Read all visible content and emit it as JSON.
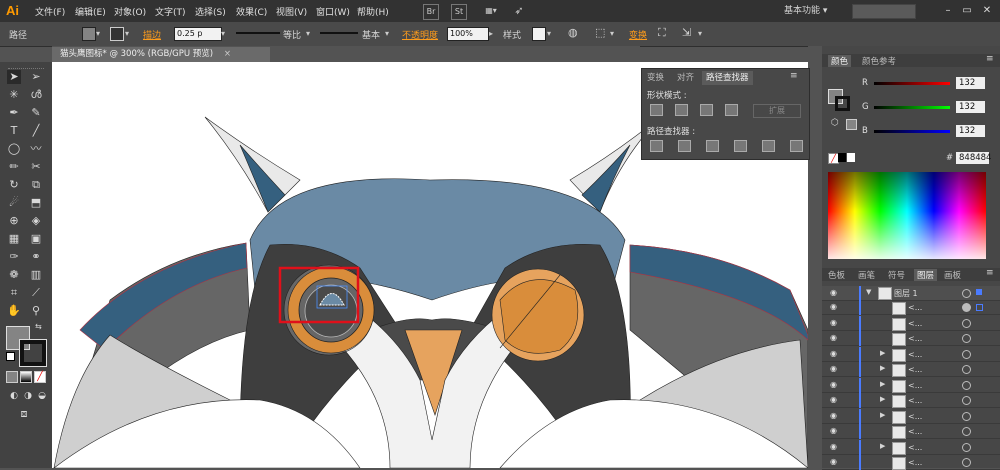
{
  "app": {
    "logo": "Ai"
  },
  "menu": [
    "文件(F)",
    "编辑(E)",
    "对象(O)",
    "文字(T)",
    "选择(S)",
    "效果(C)",
    "视图(V)",
    "窗口(W)",
    "帮助(H)"
  ],
  "menubar_tools": {
    "bridge": "Br",
    "stock": "St"
  },
  "workspace": {
    "label": "基本功能",
    "arrow": "▾"
  },
  "search": {
    "placeholder": ""
  },
  "control": {
    "object_type": "路径",
    "stroke_label": "描边",
    "stroke_value": "0.25 p",
    "profile": "等比",
    "brush": "基本",
    "opacity_label": "不透明度",
    "opacity_value": "100%",
    "style_label": "样式",
    "transform_label": "变换"
  },
  "document": {
    "tab_title": "猫头鹰图标* @ 300% (RGB/GPU 预览)",
    "close": "×"
  },
  "pathfinder": {
    "tabs": [
      "变换",
      "对齐",
      "路径查找器"
    ],
    "active_tab": "路径查找器",
    "shape_modes_label": "形状模式 :",
    "pathfinders_label": "路径查找器 :",
    "expand_label": "扩展"
  },
  "color_panel": {
    "tabs": [
      "颜色",
      "颜色参考"
    ],
    "r_label": "R",
    "g_label": "G",
    "b_label": "B",
    "r_value": "132",
    "g_value": "132",
    "b_value": "132",
    "hex_label": "#",
    "hex_value": "848484",
    "fill_color": "#848484"
  },
  "layers_panel": {
    "tabs": [
      "色板",
      "画笔",
      "符号",
      "图层",
      "画板"
    ],
    "active_tab": "图层",
    "layer_name": "图层 1",
    "sublayer_name": "<...",
    "sublayer_count": 11
  },
  "canvas_colors": {
    "slate_blue": "#35607f",
    "face_blue": "#6a8aa5",
    "dark_gray": "#3e3e3e",
    "mid_gray": "#666666",
    "light_gray": "#c8c8c8",
    "orange": "#e6a35e",
    "deep_orange": "#d98d3b",
    "highlight_red": "#e0101a"
  }
}
